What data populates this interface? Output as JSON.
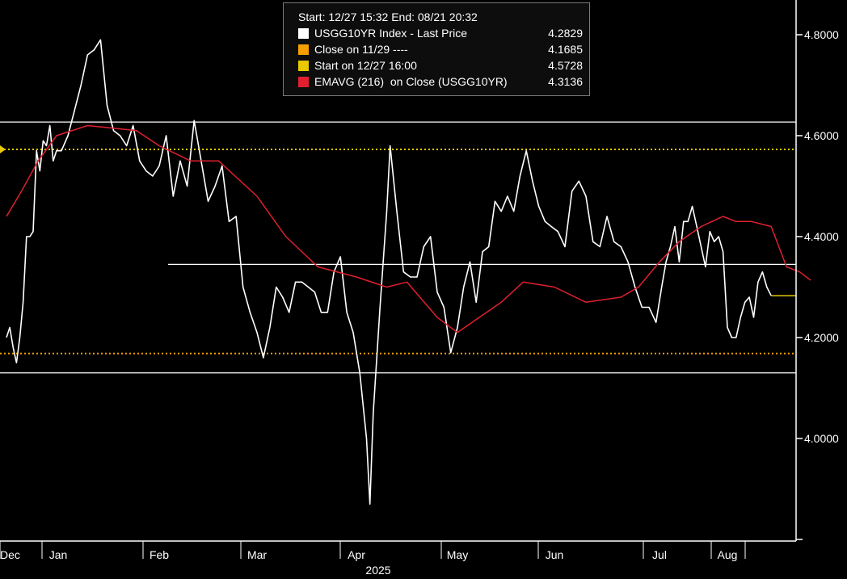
{
  "legend": {
    "header": "Start: 12/27 15:32 End: 08/21 20:32",
    "items": [
      {
        "label": "USGG10YR Index - Last Price",
        "value": "4.2829",
        "color": "#ffffff"
      },
      {
        "label": "Close on 11/29 ----",
        "value": "4.1685",
        "color": "#f5a000"
      },
      {
        "label": "Start on 12/27 16:00",
        "value": "4.5728",
        "color": "#e8c800"
      },
      {
        "label": "EMAVG (216)  on Close (USGG10YR)",
        "value": "4.3136",
        "color": "#e0202e"
      }
    ]
  },
  "chart_data": {
    "type": "line",
    "title": "",
    "xlabel": "2025",
    "ylabel": "",
    "ylim": [
      3.8,
      5.0
    ],
    "y_ticks": [
      "4.0000",
      "4.2000",
      "4.4000",
      "4.6000",
      "4.8000"
    ],
    "x_ticks": [
      "Dec",
      "Jan",
      "Feb",
      "Mar",
      "Apr",
      "May",
      "Jun",
      "Jul",
      "Aug"
    ],
    "x_tick_dates": [
      "2024-12-01",
      "2025-01-01",
      "2025-02-01",
      "2025-03-01",
      "2025-04-01",
      "2025-05-01",
      "2025-06-01",
      "2025-07-01",
      "2025-08-01"
    ],
    "x_range": [
      "2024-12-01",
      "2025-09-08"
    ],
    "series": [
      {
        "name": "USGG10YR Index - Last Price",
        "color": "#ffffff",
        "points": [
          [
            "2024-12-01",
            4.2
          ],
          [
            "2024-12-03",
            4.22
          ],
          [
            "2024-12-05",
            4.18
          ],
          [
            "2024-12-07",
            4.15
          ],
          [
            "2024-12-09",
            4.2
          ],
          [
            "2024-12-11",
            4.27
          ],
          [
            "2024-12-13",
            4.4
          ],
          [
            "2024-12-15",
            4.4
          ],
          [
            "2024-12-17",
            4.41
          ],
          [
            "2024-12-19",
            4.57
          ],
          [
            "2024-12-21",
            4.53
          ],
          [
            "2024-12-23",
            4.59
          ],
          [
            "2024-12-25",
            4.58
          ],
          [
            "2024-12-27",
            4.62
          ],
          [
            "2024-12-29",
            4.55
          ],
          [
            "2024-12-31",
            4.57
          ],
          [
            "2025-01-02",
            4.57
          ],
          [
            "2025-01-04",
            4.6
          ],
          [
            "2025-01-06",
            4.65
          ],
          [
            "2025-01-08",
            4.7
          ],
          [
            "2025-01-10",
            4.76
          ],
          [
            "2025-01-12",
            4.77
          ],
          [
            "2025-01-14",
            4.79
          ],
          [
            "2025-01-16",
            4.66
          ],
          [
            "2025-01-18",
            4.61
          ],
          [
            "2025-01-20",
            4.6
          ],
          [
            "2025-01-22",
            4.58
          ],
          [
            "2025-01-24",
            4.62
          ],
          [
            "2025-01-26",
            4.55
          ],
          [
            "2025-01-28",
            4.53
          ],
          [
            "2025-01-30",
            4.52
          ],
          [
            "2025-02-01",
            4.54
          ],
          [
            "2025-02-03",
            4.6
          ],
          [
            "2025-02-05",
            4.48
          ],
          [
            "2025-02-07",
            4.55
          ],
          [
            "2025-02-09",
            4.5
          ],
          [
            "2025-02-11",
            4.63
          ],
          [
            "2025-02-13",
            4.55
          ],
          [
            "2025-02-15",
            4.47
          ],
          [
            "2025-02-17",
            4.5
          ],
          [
            "2025-02-19",
            4.54
          ],
          [
            "2025-02-21",
            4.43
          ],
          [
            "2025-02-23",
            4.44
          ],
          [
            "2025-02-25",
            4.3
          ],
          [
            "2025-02-27",
            4.25
          ],
          [
            "2025-03-01",
            4.21
          ],
          [
            "2025-03-03",
            4.16
          ],
          [
            "2025-03-05",
            4.22
          ],
          [
            "2025-03-07",
            4.3
          ],
          [
            "2025-03-09",
            4.28
          ],
          [
            "2025-03-11",
            4.25
          ],
          [
            "2025-03-13",
            4.31
          ],
          [
            "2025-03-15",
            4.31
          ],
          [
            "2025-03-17",
            4.3
          ],
          [
            "2025-03-19",
            4.29
          ],
          [
            "2025-03-21",
            4.25
          ],
          [
            "2025-03-23",
            4.25
          ],
          [
            "2025-03-25",
            4.33
          ],
          [
            "2025-03-27",
            4.36
          ],
          [
            "2025-03-29",
            4.25
          ],
          [
            "2025-03-31",
            4.21
          ],
          [
            "2025-04-02",
            4.13
          ],
          [
            "2025-04-04",
            4.0
          ],
          [
            "2025-04-05",
            3.87
          ],
          [
            "2025-04-06",
            4.05
          ],
          [
            "2025-04-08",
            4.26
          ],
          [
            "2025-04-10",
            4.45
          ],
          [
            "2025-04-11",
            4.58
          ],
          [
            "2025-04-13",
            4.45
          ],
          [
            "2025-04-15",
            4.33
          ],
          [
            "2025-04-17",
            4.32
          ],
          [
            "2025-04-19",
            4.32
          ],
          [
            "2025-04-21",
            4.38
          ],
          [
            "2025-04-23",
            4.4
          ],
          [
            "2025-04-25",
            4.29
          ],
          [
            "2025-04-27",
            4.26
          ],
          [
            "2025-04-29",
            4.17
          ],
          [
            "2025-05-01",
            4.22
          ],
          [
            "2025-05-03",
            4.3
          ],
          [
            "2025-05-05",
            4.35
          ],
          [
            "2025-05-07",
            4.27
          ],
          [
            "2025-05-09",
            4.37
          ],
          [
            "2025-05-11",
            4.38
          ],
          [
            "2025-05-13",
            4.47
          ],
          [
            "2025-05-15",
            4.45
          ],
          [
            "2025-05-17",
            4.48
          ],
          [
            "2025-05-19",
            4.45
          ],
          [
            "2025-05-21",
            4.52
          ],
          [
            "2025-05-23",
            4.57
          ],
          [
            "2025-05-25",
            4.51
          ],
          [
            "2025-05-27",
            4.46
          ],
          [
            "2025-05-29",
            4.43
          ],
          [
            "2025-05-31",
            4.42
          ],
          [
            "2025-06-02",
            4.41
          ],
          [
            "2025-06-04",
            4.38
          ],
          [
            "2025-06-06",
            4.49
          ],
          [
            "2025-06-08",
            4.51
          ],
          [
            "2025-06-10",
            4.48
          ],
          [
            "2025-06-12",
            4.39
          ],
          [
            "2025-06-14",
            4.38
          ],
          [
            "2025-06-16",
            4.44
          ],
          [
            "2025-06-18",
            4.39
          ],
          [
            "2025-06-20",
            4.38
          ],
          [
            "2025-06-22",
            4.35
          ],
          [
            "2025-06-24",
            4.3
          ],
          [
            "2025-06-26",
            4.26
          ],
          [
            "2025-06-28",
            4.26
          ],
          [
            "2025-06-30",
            4.23
          ],
          [
            "2025-07-02",
            4.3
          ],
          [
            "2025-07-04",
            4.35
          ],
          [
            "2025-07-06",
            4.38
          ],
          [
            "2025-07-08",
            4.42
          ],
          [
            "2025-07-10",
            4.35
          ],
          [
            "2025-07-12",
            4.43
          ],
          [
            "2025-07-14",
            4.43
          ],
          [
            "2025-07-16",
            4.46
          ],
          [
            "2025-07-18",
            4.42
          ],
          [
            "2025-07-20",
            4.38
          ],
          [
            "2025-07-22",
            4.34
          ],
          [
            "2025-07-24",
            4.41
          ],
          [
            "2025-07-26",
            4.39
          ],
          [
            "2025-07-28",
            4.4
          ],
          [
            "2025-07-30",
            4.37
          ],
          [
            "2025-08-01",
            4.22
          ],
          [
            "2025-08-03",
            4.2
          ],
          [
            "2025-08-05",
            4.2
          ],
          [
            "2025-08-07",
            4.24
          ],
          [
            "2025-08-09",
            4.27
          ],
          [
            "2025-08-11",
            4.28
          ],
          [
            "2025-08-13",
            4.24
          ],
          [
            "2025-08-15",
            4.31
          ],
          [
            "2025-08-17",
            4.33
          ],
          [
            "2025-08-19",
            4.3
          ],
          [
            "2025-08-21",
            4.2829
          ]
        ]
      },
      {
        "name": "EMAVG (216)  on Close (USGG10YR)",
        "color": "#e0202e",
        "points": [
          [
            "2024-12-01",
            4.44
          ],
          [
            "2024-12-10",
            4.49
          ],
          [
            "2024-12-20",
            4.55
          ],
          [
            "2024-12-31",
            4.6
          ],
          [
            "2025-01-10",
            4.62
          ],
          [
            "2025-01-25",
            4.61
          ],
          [
            "2025-02-01",
            4.58
          ],
          [
            "2025-02-10",
            4.55
          ],
          [
            "2025-02-18",
            4.55
          ],
          [
            "2025-03-01",
            4.48
          ],
          [
            "2025-03-10",
            4.4
          ],
          [
            "2025-03-20",
            4.34
          ],
          [
            "2025-04-01",
            4.32
          ],
          [
            "2025-04-10",
            4.3
          ],
          [
            "2025-04-16",
            4.31
          ],
          [
            "2025-04-25",
            4.24
          ],
          [
            "2025-05-01",
            4.21
          ],
          [
            "2025-05-08",
            4.24
          ],
          [
            "2025-05-15",
            4.27
          ],
          [
            "2025-05-22",
            4.31
          ],
          [
            "2025-06-01",
            4.3
          ],
          [
            "2025-06-10",
            4.27
          ],
          [
            "2025-06-20",
            4.28
          ],
          [
            "2025-06-25",
            4.3
          ],
          [
            "2025-07-01",
            4.35
          ],
          [
            "2025-07-10",
            4.39
          ],
          [
            "2025-07-20",
            4.42
          ],
          [
            "2025-07-30",
            4.44
          ],
          [
            "2025-08-05",
            4.43
          ],
          [
            "2025-08-12",
            4.43
          ],
          [
            "2025-08-21",
            4.42
          ],
          [
            "2025-08-28",
            4.34
          ],
          [
            "2025-09-03",
            4.33
          ],
          [
            "2025-09-08",
            4.3136
          ]
        ]
      }
    ],
    "reference_lines": [
      {
        "name": "Close on 11/29",
        "value": 4.1685,
        "color": "#f5a000",
        "style": "dotted"
      },
      {
        "name": "Start on 12/27 16:00",
        "value": 4.5728,
        "color": "#e8c800",
        "style": "dotted"
      },
      {
        "name": "Level 4.6270",
        "value": 4.627,
        "color": "#ffffff",
        "style": "solid"
      },
      {
        "name": "Level 4.3450",
        "value": 4.345,
        "color": "#ffffff",
        "style": "solid"
      },
      {
        "name": "Level 4.1300",
        "value": 4.13,
        "color": "#ffffff",
        "style": "solid"
      }
    ],
    "last_value_marker": {
      "value": 4.2829,
      "color": "#e8c800"
    },
    "grid": false,
    "legend_position": "top-center"
  }
}
